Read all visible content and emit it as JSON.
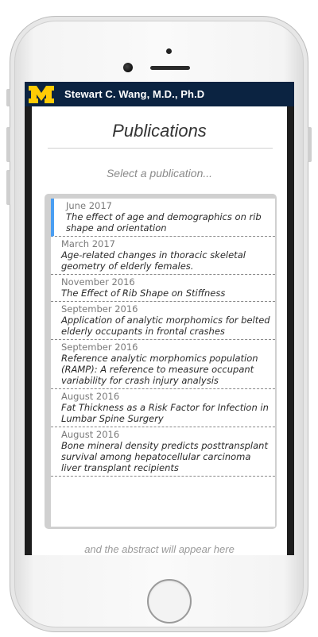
{
  "header": {
    "logo_letter": "M",
    "title": "Stewart C. Wang, M.D., Ph.D"
  },
  "colors": {
    "header_bg": "#0b2341",
    "logo_yellow": "#ffcb05",
    "selected_accent": "#4a9ef2"
  },
  "page": {
    "title": "Publications",
    "prompt": "Select a publication...",
    "abstract_hint": "and the abstract will appear here"
  },
  "publications": [
    {
      "date": "June 2017",
      "title": "The effect of age and demographics on rib shape and orientation",
      "selected": true
    },
    {
      "date": "March 2017",
      "title": "Age-related changes in thoracic skeletal geometry of elderly females.",
      "selected": false
    },
    {
      "date": "November 2016",
      "title": "The Effect of Rib Shape on Stiffness",
      "selected": false
    },
    {
      "date": "September 2016",
      "title": "Application of analytic morphomics for belted elderly occupants in frontal crashes",
      "selected": false
    },
    {
      "date": "September 2016",
      "title": "Reference analytic morphomics population (RAMP): A reference to measure occupant variability for crash injury analysis",
      "selected": false
    },
    {
      "date": "August 2016",
      "title": "Fat Thickness as a Risk Factor for Infection in Lumbar Spine Surgery",
      "selected": false
    },
    {
      "date": "August 2016",
      "title": "Bone mineral density predicts posttransplant survival among hepatocellular carcinoma liver transplant recipients",
      "selected": false
    }
  ]
}
